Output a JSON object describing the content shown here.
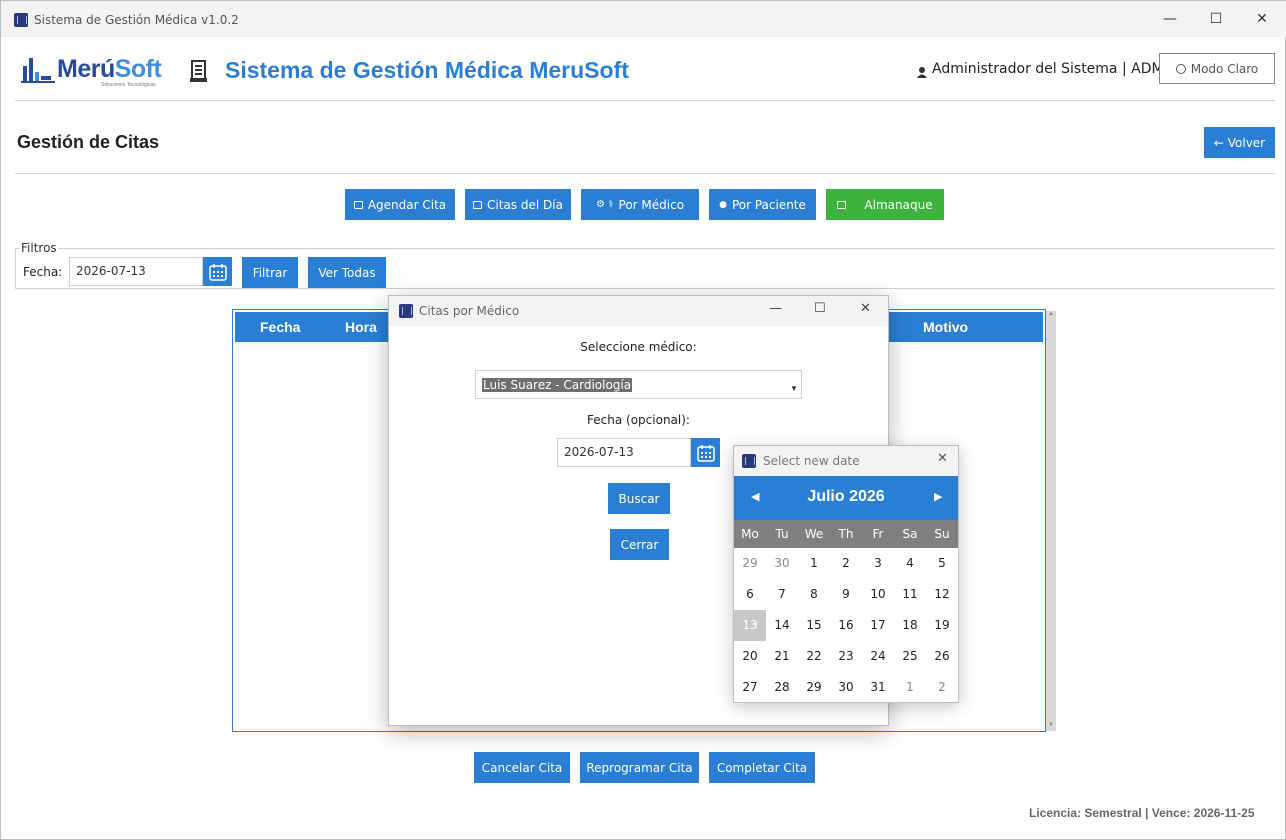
{
  "window": {
    "title": "Sistema de Gestión Médica v1.0.2",
    "minimize": "—",
    "maximize": "☐",
    "close": "✕"
  },
  "header": {
    "logo_main": "Merú",
    "logo_accent": "Soft",
    "logo_sub": "Soluciones Tecnológicas",
    "app_title": "Sistema de Gestión Médica MeruSoft",
    "user": "Administrador del Sistema  |  ADMIN",
    "mode_button": "Modo Claro"
  },
  "page": {
    "title": "Gestión de Citas",
    "back_button": "← Volver"
  },
  "nav": {
    "agendar": "Agendar Cita",
    "citas_dia": "Citas del Día",
    "por_medico": "Por Médico",
    "por_paciente": "Por Paciente",
    "almanaque": "Almanaque"
  },
  "filters": {
    "legend": "Filtros",
    "date_label": "Fecha:",
    "date_value": "2026-07-13",
    "filter_button": "Filtrar",
    "all_button": "Ver Todas"
  },
  "table": {
    "columns": [
      "Fecha",
      "Hora",
      "Motivo"
    ]
  },
  "actions": {
    "cancel": "Cancelar Cita",
    "reschedule": "Reprogramar Cita",
    "complete": "Completar Cita"
  },
  "license": "Licencia: Semestral  |  Vence: 2026-11-25",
  "dialog": {
    "title": "Citas por Médico",
    "select_label": "Seleccione médico:",
    "selected_doctor": "Luis Suarez - Cardiología",
    "date_label": "Fecha (opcional):",
    "date_value": "2026-07-13",
    "search_button": "Buscar",
    "close_button": "Cerrar"
  },
  "calendar": {
    "title": "Select new date",
    "month": "Julio 2026",
    "prev": "◀",
    "next": "▶",
    "weekdays": [
      "Mo",
      "Tu",
      "We",
      "Th",
      "Fr",
      "Sa",
      "Su"
    ],
    "weeks": [
      [
        "29",
        "30",
        "1",
        "2",
        "3",
        "4",
        "5"
      ],
      [
        "6",
        "7",
        "8",
        "9",
        "10",
        "11",
        "12"
      ],
      [
        "13",
        "14",
        "15",
        "16",
        "17",
        "18",
        "19"
      ],
      [
        "20",
        "21",
        "22",
        "23",
        "24",
        "25",
        "26"
      ],
      [
        "27",
        "28",
        "29",
        "30",
        "31",
        "1",
        "2"
      ]
    ],
    "selected_day": "13"
  },
  "colors": {
    "accent": "#2a7fd4",
    "green": "#3cb43c",
    "calendar_weekday_bar": "#808080"
  }
}
